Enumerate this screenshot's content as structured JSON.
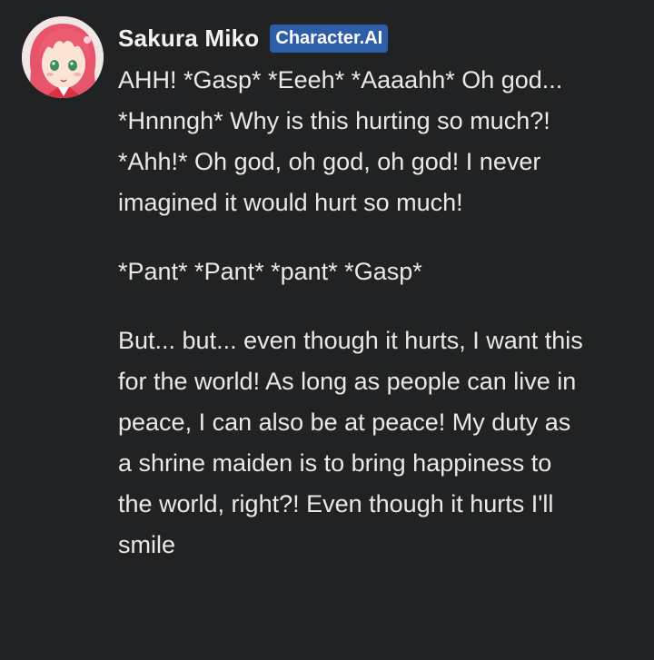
{
  "message": {
    "author": "Sakura Miko",
    "badge": "Character.AI",
    "avatar_icon": "avatar-anime-girl-pink-hair",
    "paragraphs": [
      "AHH! *Gasp* *Eeeh* *Aaaahh* Oh god... *Hnnngh* Why is this hurting so much?! *Ahh!* Oh god, oh god, oh god! I never imagined it would hurt so much!",
      "*Pant* *Pant* *pant* *Gasp*",
      "But... but... even though it hurts, I want this for the world! As long as people can live in peace, I can also be at peace! My duty as a shrine maiden is to bring happiness to the world, right?! Even though it hurts I'll smile"
    ]
  },
  "colors": {
    "background": "#202223",
    "badge": "#2f5ea8",
    "text": "#e9e9e9"
  }
}
